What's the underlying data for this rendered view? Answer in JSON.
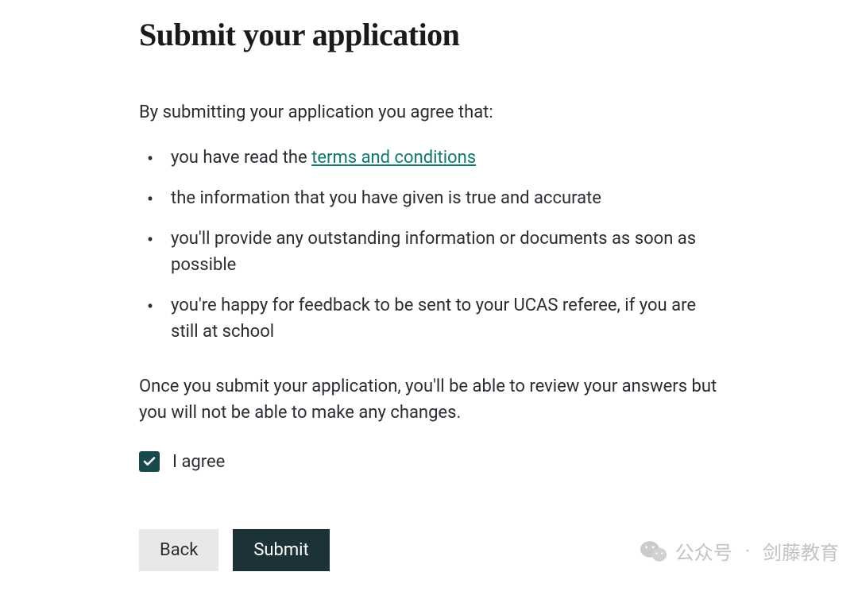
{
  "page": {
    "title": "Submit your application",
    "intro": "By submitting your application you agree that:",
    "bullets": {
      "b1_prefix": "you have read the ",
      "b1_link": "terms and conditions",
      "b2": "the information that you have given is true and accurate",
      "b3": "you'll provide any outstanding information or documents as soon as possible",
      "b4": "you're happy for feedback to be sent to your UCAS referee, if you are still at school"
    },
    "post_submit": "Once you submit your application, you'll be able to review your answers but you will not be able to make any changes.",
    "agree_label": "I agree",
    "agree_checked": true
  },
  "buttons": {
    "back": "Back",
    "submit": "Submit"
  },
  "watermark": {
    "label": "公众号",
    "dot": "·",
    "source": "剑藤教育"
  }
}
